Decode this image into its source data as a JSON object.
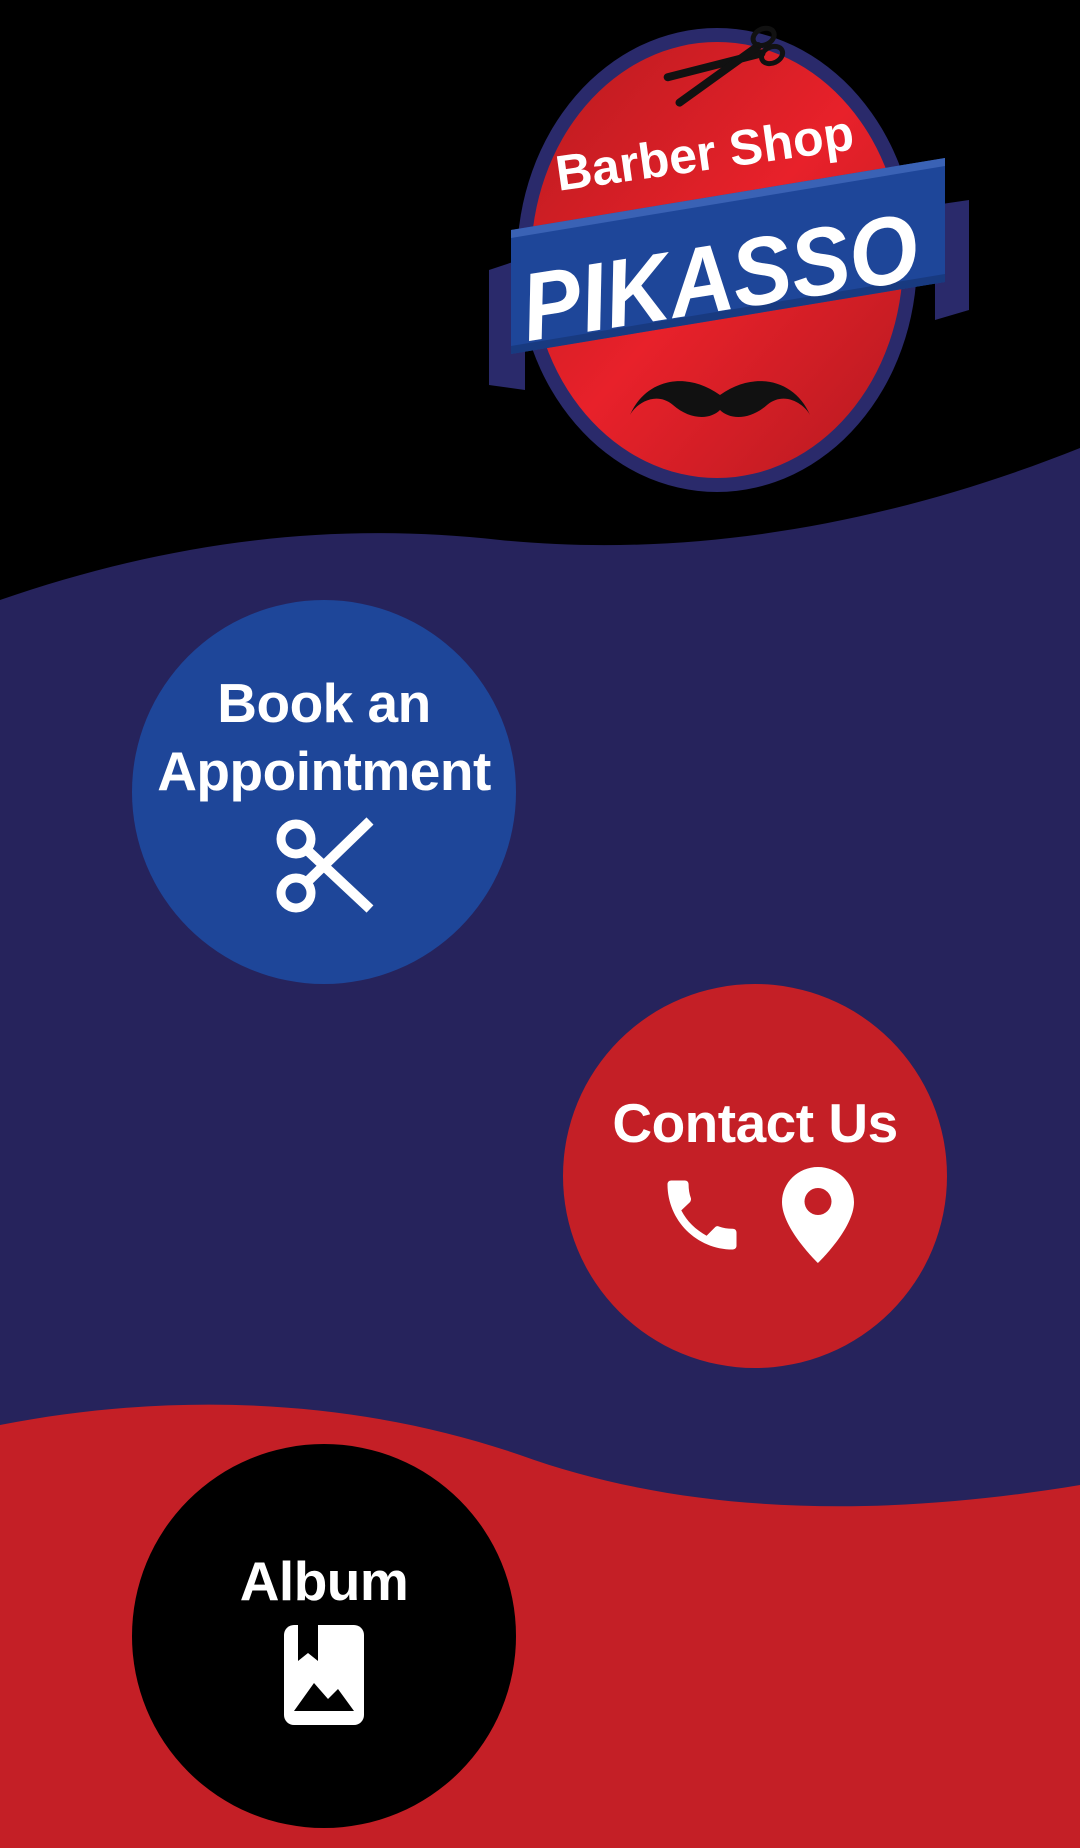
{
  "logo": {
    "line1": "Barber Shop",
    "line2": "PIKASSO"
  },
  "buttons": {
    "book": {
      "label": "Book an\nAppointment",
      "icon": "scissors-icon"
    },
    "contact": {
      "label": "Contact Us",
      "icons": [
        "phone-icon",
        "location-pin-icon"
      ]
    },
    "album": {
      "label": "Album",
      "icon": "photo-album-icon"
    }
  },
  "colors": {
    "top_bg": "#000000",
    "middle_bg": "#26235c",
    "bottom_bg": "#c41f26",
    "book_button": "#1e4699",
    "contact_button": "#c41f26",
    "album_button": "#000000"
  }
}
